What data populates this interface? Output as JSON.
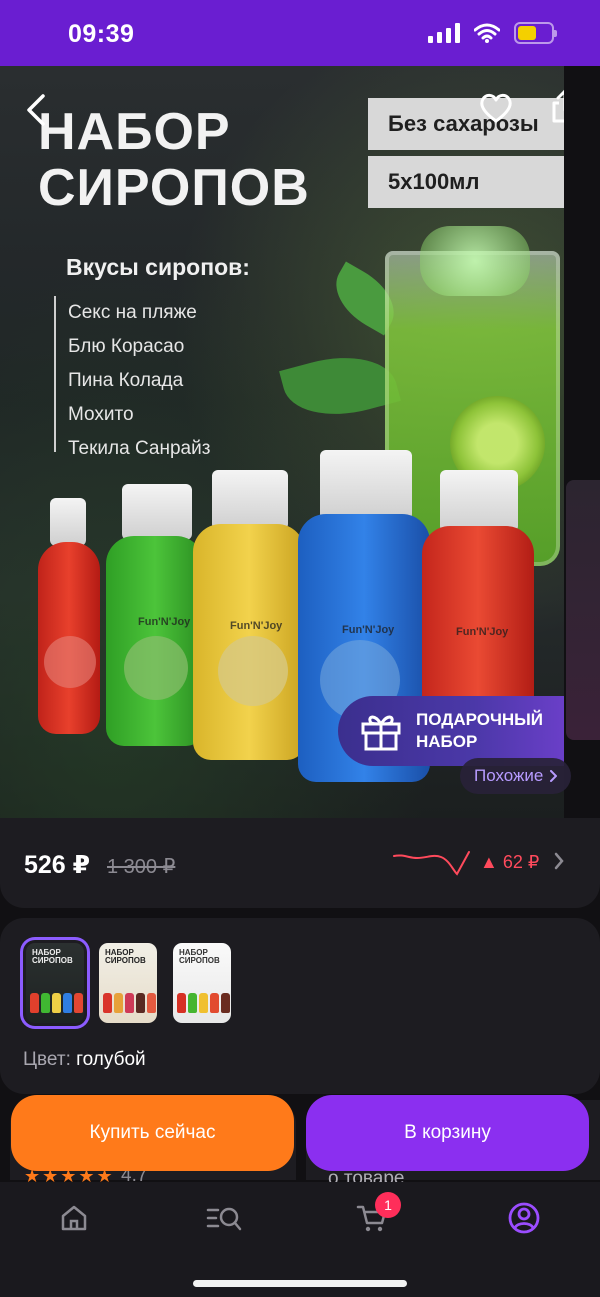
{
  "status_bar": {
    "time": "09:39"
  },
  "hero": {
    "title_line1": "НАБОР",
    "title_line2": "СИРОПОВ",
    "tag_sugar": "Без сахарозы",
    "tag_volume": "5х100мл",
    "flavors_title": "Вкусы сиропов:",
    "flavors": [
      "Секс на пляже",
      "Блю Корасао",
      "Пина Колада",
      "Мохито",
      "Текила Санрайз"
    ],
    "gift_line1": "ПОДАРОЧНЫЙ",
    "gift_line2": "НАБОР",
    "similar_label": "Похожие",
    "icons": {
      "back": "back-arrow-icon",
      "favorite": "heart-icon",
      "share": "share-icon"
    }
  },
  "price": {
    "current": "526 ₽",
    "old": "1 300 ₽",
    "change": "▲ 62 ₽",
    "trend_color": "#ff4a5c"
  },
  "variants": {
    "color_label": "Цвет:",
    "color_value": "голубой",
    "thumb_title": "НАБОР СИРОПОВ"
  },
  "under": {
    "stars": "★★★★★",
    "rating": "4.7",
    "about": "о товаре"
  },
  "actions": {
    "buy_now": "Купить сейчас",
    "to_cart": "В корзину"
  },
  "tab_bar": {
    "cart_count": "1",
    "accent": "#8b2ff0"
  }
}
